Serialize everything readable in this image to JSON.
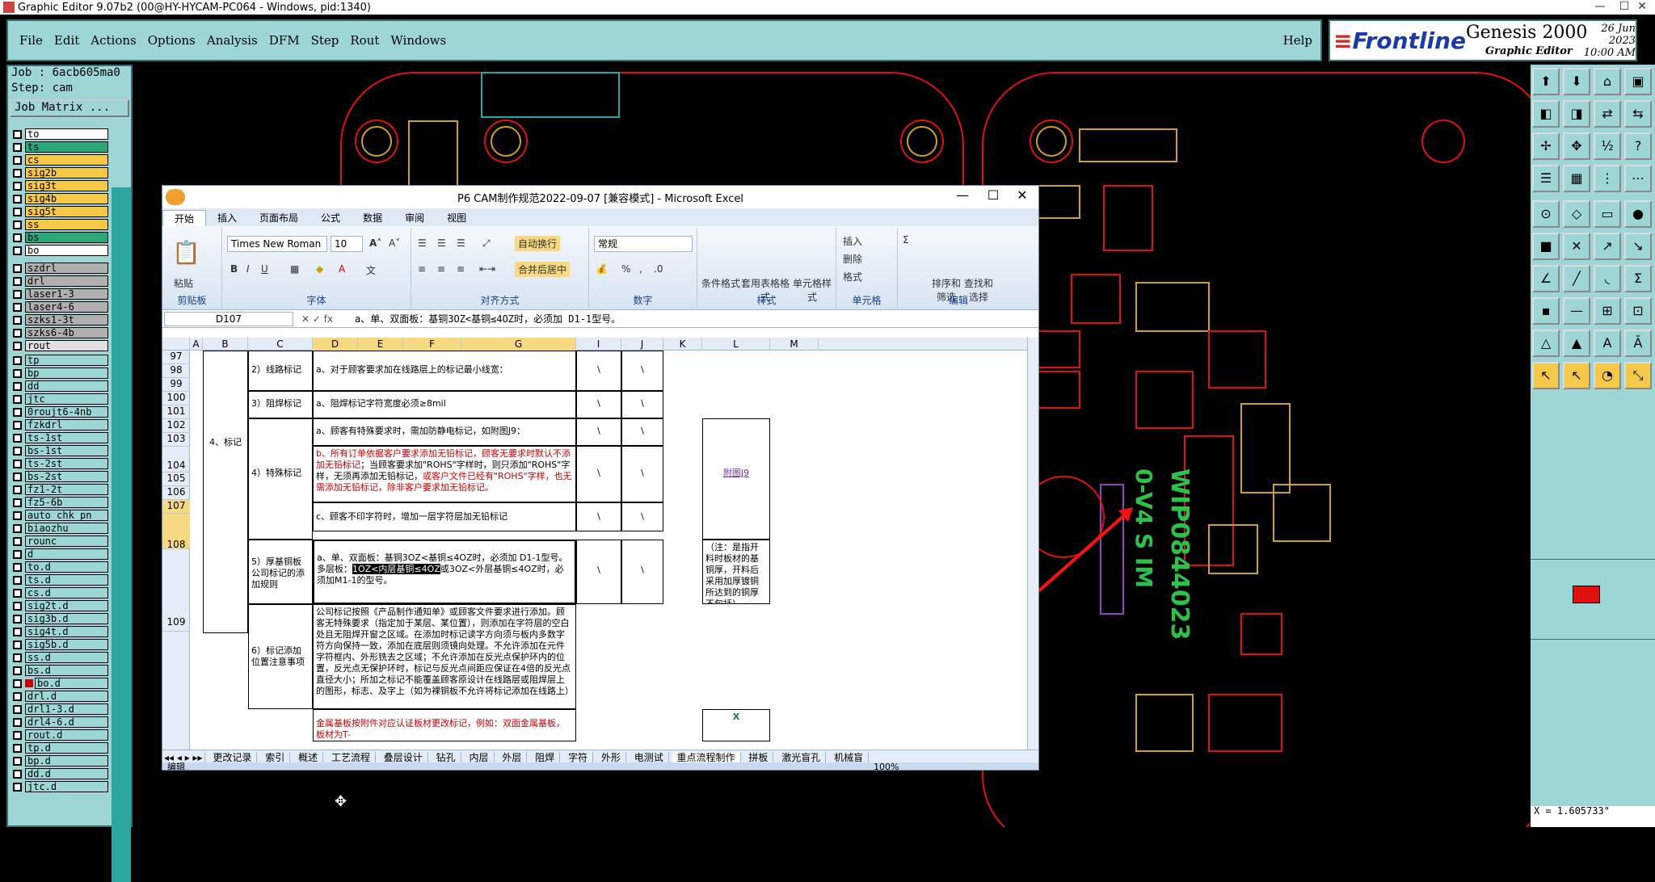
{
  "window_title": "Graphic Editor 9.07b2 (00@HY-HYCAM-PC064 - Windows, pid:1340)",
  "menu": {
    "file": "File",
    "edit": "Edit",
    "actions": "Actions",
    "options": "Options",
    "analysis": "Analysis",
    "dfm": "DFM",
    "step": "Step",
    "rout": "Rout",
    "windows": "Windows",
    "help": "Help"
  },
  "brand": {
    "logo": "Frontline",
    "product": "Genesis 2000",
    "sub": "Graphic Editor",
    "date_line1": "26 Jun 2023",
    "date_line2": "10:00 AM"
  },
  "job": {
    "job_label": "Job : 6acb605ma0",
    "step_label": "Step: cam",
    "matrix_button": "Job Matrix ..."
  },
  "layers_board": [
    {
      "name": "to",
      "color": "#ffffff"
    },
    {
      "name": "ts",
      "color": "#2ca67a"
    },
    {
      "name": "cs",
      "color": "#f6c84a"
    },
    {
      "name": "sig2b",
      "color": "#f6c84a"
    },
    {
      "name": "sig3t",
      "color": "#f6c84a"
    },
    {
      "name": "sig4b",
      "color": "#f6c84a"
    },
    {
      "name": "sig5t",
      "color": "#f6c84a"
    },
    {
      "name": "ss",
      "color": "#f6c84a"
    },
    {
      "name": "bs",
      "color": "#2ca67a"
    },
    {
      "name": "bo",
      "color": "#ffffff"
    }
  ],
  "layers_drill": [
    {
      "name": "szdrl",
      "color": "#b0b0b0"
    },
    {
      "name": "drl",
      "color": "#b0b0b0"
    },
    {
      "name": "laser1-3",
      "color": "#b0b0b0"
    },
    {
      "name": "laser4-6",
      "color": "#b0b0b0"
    },
    {
      "name": "szks1-3t",
      "color": "#b0b0b0"
    },
    {
      "name": "szks6-4b",
      "color": "#b0b0b0"
    },
    {
      "name": "rout",
      "color": "#e0e0e0"
    }
  ],
  "layers_misc": [
    {
      "name": "tp",
      "color": "#9ed6d6"
    },
    {
      "name": "bp",
      "color": "#9ed6d6"
    },
    {
      "name": "dd",
      "color": "#9ed6d6"
    },
    {
      "name": "jtc",
      "color": "#9ed6d6"
    },
    {
      "name": "0roujt6-4nb",
      "color": "#9ed6d6"
    },
    {
      "name": "fzkdrl",
      "color": "#9ed6d6"
    },
    {
      "name": "ts-1st",
      "color": "#9ed6d6"
    },
    {
      "name": "bs-1st",
      "color": "#9ed6d6"
    },
    {
      "name": "ts-2st",
      "color": "#9ed6d6"
    },
    {
      "name": "bs-2st",
      "color": "#9ed6d6"
    },
    {
      "name": "fz1-2t",
      "color": "#9ed6d6"
    },
    {
      "name": "fz5-6b",
      "color": "#9ed6d6"
    },
    {
      "name": "auto_chk_pn",
      "color": "#9ed6d6"
    },
    {
      "name": "biaozhu",
      "color": "#9ed6d6"
    },
    {
      "name": "rounc",
      "color": "#9ed6d6"
    },
    {
      "name": "d",
      "color": "#9ed6d6"
    },
    {
      "name": "to.d",
      "color": "#9ed6d6"
    },
    {
      "name": "ts.d",
      "color": "#9ed6d6"
    },
    {
      "name": "cs.d",
      "color": "#9ed6d6"
    },
    {
      "name": "sig2t.d",
      "color": "#9ed6d6"
    },
    {
      "name": "sig3b.d",
      "color": "#9ed6d6"
    },
    {
      "name": "sig4t.d",
      "color": "#9ed6d6"
    },
    {
      "name": "sig5b.d",
      "color": "#9ed6d6"
    },
    {
      "name": "ss.d",
      "color": "#9ed6d6"
    },
    {
      "name": "bs.d",
      "color": "#9ed6d6"
    },
    {
      "name": "bo.d",
      "color": "#9ed6d6"
    },
    {
      "name": "drl.d",
      "color": "#9ed6d6"
    },
    {
      "name": "drl1-3.d",
      "color": "#9ed6d6"
    },
    {
      "name": "drl4-6.d",
      "color": "#9ed6d6"
    },
    {
      "name": "rout.d",
      "color": "#9ed6d6"
    },
    {
      "name": "tp.d",
      "color": "#9ed6d6"
    },
    {
      "name": "bp.d",
      "color": "#9ed6d6"
    },
    {
      "name": "dd.d",
      "color": "#9ed6d6"
    },
    {
      "name": "jtc.d",
      "color": "#9ed6d6"
    }
  ],
  "coords": {
    "x": "X = 1.605733\""
  },
  "pcb_text": {
    "line1": "WIP0844023",
    "line2": "0-V4 S IM"
  },
  "excel": {
    "title": "P6 CAM制作规范2022-09-07  [兼容模式] - Microsoft Excel",
    "tabs": [
      "开始",
      "插入",
      "页面布局",
      "公式",
      "数据",
      "审阅",
      "视图"
    ],
    "font_name": "Times New Roman",
    "font_size": "10",
    "number_format": "常规",
    "groups": {
      "clipboard": "剪贴板",
      "font": "字体",
      "align": "对齐方式",
      "number": "数字",
      "styles": "样式",
      "cells": "单元格",
      "edit": "编辑"
    },
    "buttons": {
      "paste": "粘贴",
      "wrap": "自动换行",
      "merge": "合并后居中",
      "cond": "条件格式",
      "table": "套用表格格式",
      "cellstyle": "单元格样式",
      "insert": "插入",
      "delete": "删除",
      "format": "格式",
      "sort": "排序和筛选",
      "find": "查找和选择"
    },
    "name_box": "D107",
    "formula": "a、单、双面板：基铜3OZ<基铜≤4OZ时，必须加 D1-1型号。",
    "columns": [
      "A",
      "B",
      "C",
      "D",
      "E",
      "F",
      "G",
      "I",
      "J",
      "K",
      "L",
      "M"
    ],
    "rows": [
      "97",
      "98",
      "99",
      "100",
      "101",
      "102",
      "103",
      "104",
      "105",
      "106",
      "107",
      "108",
      "109"
    ],
    "cells": {
      "b_mark": "4、标记",
      "c98": "2）线路标记",
      "d98": "a、对于顾客要求加在线路层上的标记最小线宽：",
      "c100": "3）阻焊标记",
      "d100": "a、阻焊标记字符宽度必须≥8mil",
      "c103": "4）特殊标记",
      "d102": "a、顾客有特殊要求时，需加防静电标记，如附图J9：",
      "d104a": "b、所有订单依据客户要求添加无铅标记，顾客无要求时默认不添加无铅标记",
      "d104b": "；当顾客要求加\"ROHS\"字样时，则只添加\"ROHS\"字样，无须再添加无铅标记，",
      "d104c": "或客户文件已经有\"ROHS\"字样，也无需添加无铅标记，除非客户要求加无铅标记。",
      "d106": "c、顾客不印字符时，增加一层字符层加无铅标记",
      "l103": "附图J9",
      "c107": "5）厚基铜板公司标记的添加规则",
      "d107a": "a、单、双面板：基铜3OZ<基铜≤4OZ时，必须加 D1-1型号。",
      "d107b": "多层板：",
      "d107hl": "1OZ<内层基铜≤4OZ",
      "d107c": "或3OZ<外层基铜≤4OZ时，必须加M1-1的型号。",
      "l107": "（注：是指开料时板材的基铜厚，开料后采用加厚镀铜所达到的铜厚不包括）",
      "c109": "6）标记添加位置注意事项",
      "d109": "公司标记按照《产品制作通知单》或顾客文件要求进行添加。顾客无特殊要求（指定加于某层、某位置），则添加在字符层的空白处且无阻焊开窗之区域。在添加时标记读字方向须与板内多数字符方向保持一致，添加在底层则须镜向处理。不允许添加在元件字符框内、外形铣去之区域；不允许添加在反光点保护环内的位置，反光点无保护环时，标记与反光点间距应保证在4倍的反光点直径大小；所加之标记不能覆盖顾客原设计在线路层或阻焊层上的图形，标志、及字上（如为裸铜板不允许将标记添加在线路上）",
      "d110": "金属基板按附件对应认证板材更改标记，例如：双面金属基板，板材为T-",
      "slash": "\\"
    },
    "sheets": [
      "更改记录",
      "索引",
      "概述",
      "工艺流程",
      "叠层设计",
      "钻孔",
      "内层",
      "外层",
      "阻焊",
      "字符",
      "外形",
      "电测试",
      "重点流程制作",
      "拼板",
      "激光盲孔",
      "机械盲"
    ],
    "status": "编辑",
    "zoom": "100%"
  }
}
